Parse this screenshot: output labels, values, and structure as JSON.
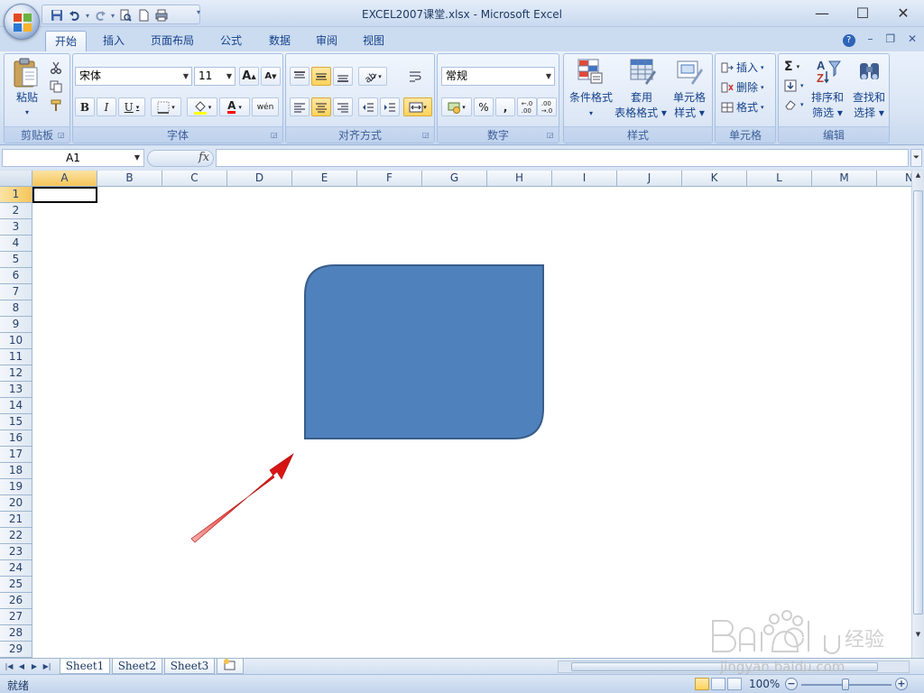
{
  "window": {
    "title": "EXCEL2007课堂.xlsx - Microsoft Excel",
    "controls": {
      "minimize": "—",
      "maximize": "☐",
      "close": "✕"
    }
  },
  "ribbon_tabs": [
    {
      "label": "开始",
      "active": true
    },
    {
      "label": "插入"
    },
    {
      "label": "页面布局"
    },
    {
      "label": "公式"
    },
    {
      "label": "数据"
    },
    {
      "label": "审阅"
    },
    {
      "label": "视图"
    }
  ],
  "groups": {
    "clipboard": {
      "label": "剪贴板",
      "paste_label": "粘贴"
    },
    "font": {
      "label": "字体",
      "font_name": "宋体",
      "font_size": "11",
      "bold": "B",
      "italic": "I",
      "underline": "U",
      "grow": "A",
      "shrink": "A",
      "color_letter": "A",
      "phonetic": "wén"
    },
    "alignment": {
      "label": "对齐方式"
    },
    "number": {
      "label": "数字",
      "format": "常规",
      "percent": "%",
      "comma": ","
    },
    "styles": {
      "label": "样式",
      "conditional": [
        "条件格式",
        "▾"
      ],
      "table_format": [
        "套用",
        "表格格式 ▾"
      ],
      "cell_styles": [
        "单元格",
        "样式 ▾"
      ]
    },
    "cells": {
      "label": "单元格",
      "insert": "插入",
      "delete": "删除",
      "format": "格式"
    },
    "editing": {
      "label": "编辑",
      "sigma": "Σ",
      "sort": [
        "排序和",
        "筛选 ▾"
      ],
      "find": [
        "查找和",
        "选择 ▾"
      ]
    }
  },
  "formula_bar": {
    "name_box": "A1",
    "fx": "fx",
    "formula": ""
  },
  "columns": [
    "A",
    "B",
    "C",
    "D",
    "E",
    "F",
    "G",
    "H",
    "I",
    "J",
    "K",
    "L",
    "M",
    "N"
  ],
  "rows": [
    "1",
    "2",
    "3",
    "4",
    "5",
    "6",
    "7",
    "8",
    "9",
    "10",
    "11",
    "12",
    "13",
    "14",
    "15",
    "16",
    "17",
    "18",
    "19",
    "20",
    "21",
    "22",
    "23",
    "24",
    "25",
    "26",
    "27",
    "28",
    "29"
  ],
  "shape": {
    "type": "round-diagonal-corner-rectangle",
    "fill": "#4f81bd",
    "stroke": "#385d8a"
  },
  "annotation_arrow": {
    "color": "#e8231f"
  },
  "sheet_tabs": [
    {
      "label": "Sheet1",
      "active": true
    },
    {
      "label": "Sheet2"
    },
    {
      "label": "Sheet3"
    }
  ],
  "status": {
    "ready": "就绪",
    "zoom": "100%"
  },
  "watermark": {
    "text": "jingyan.baidu.com"
  }
}
